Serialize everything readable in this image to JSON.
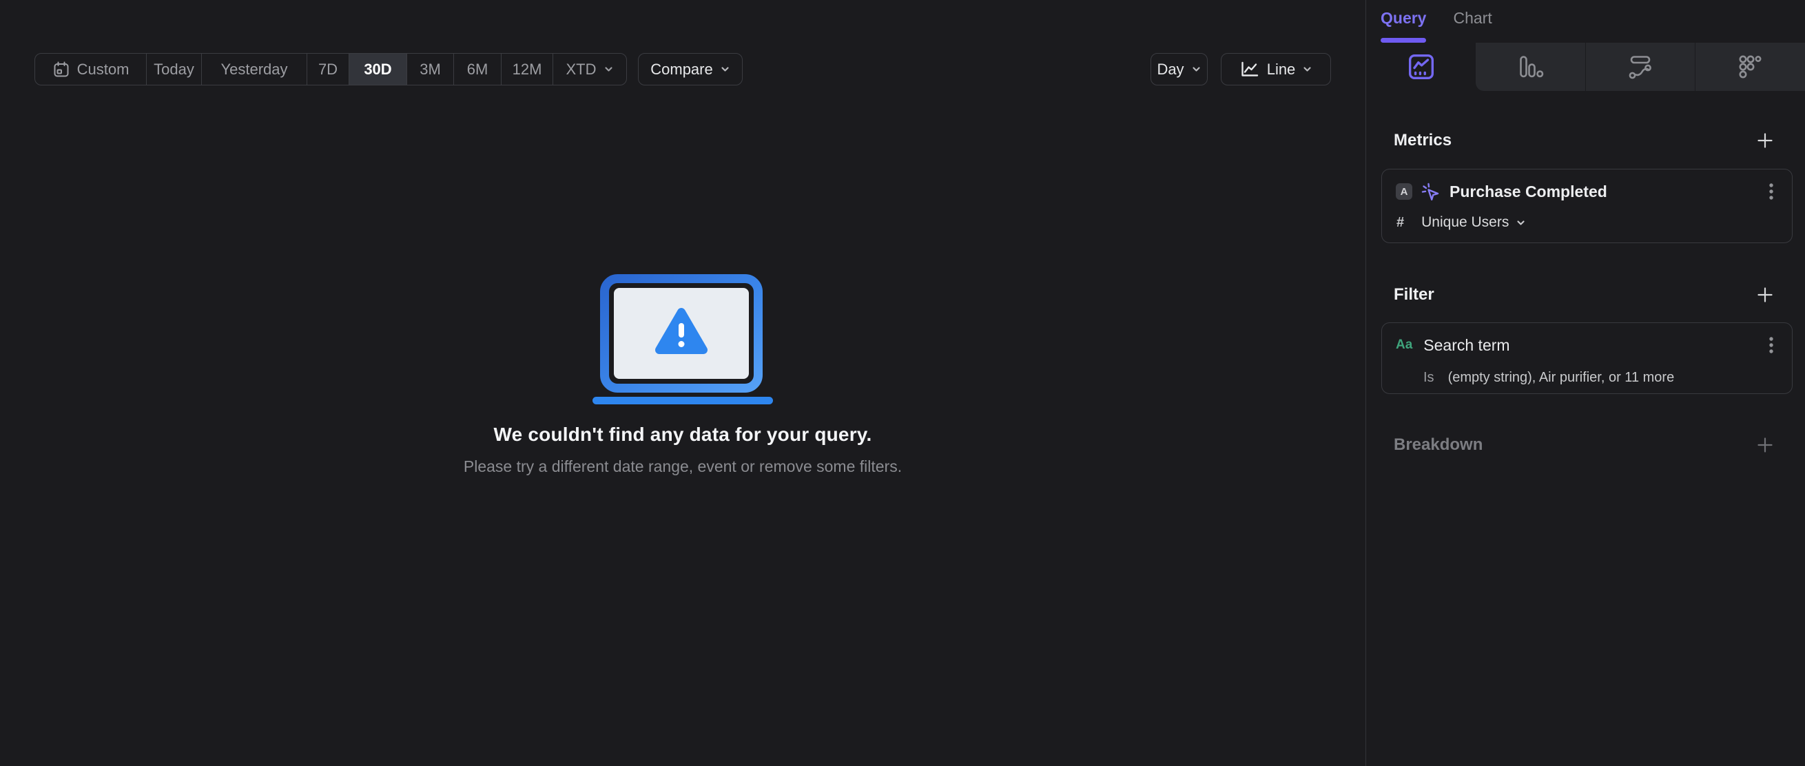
{
  "toolbar": {
    "date_ranges": [
      {
        "label": "Custom",
        "icon": "calendar-icon",
        "selected": false
      },
      {
        "label": "Today",
        "selected": false
      },
      {
        "label": "Yesterday",
        "selected": false
      },
      {
        "label": "7D",
        "selected": false
      },
      {
        "label": "30D",
        "selected": true
      },
      {
        "label": "3M",
        "selected": false
      },
      {
        "label": "6M",
        "selected": false
      },
      {
        "label": "12M",
        "selected": false
      },
      {
        "label": "XTD",
        "selected": false,
        "icon": "chevron-down-icon"
      }
    ],
    "compare_label": "Compare",
    "granularity_label": "Day",
    "chart_type_label": "Line",
    "chart_type_icon": "line-chart-icon"
  },
  "empty_state": {
    "illustration": "laptop-warning-illustration",
    "title": "We couldn't find any data for your query.",
    "subtitle": "Please try a different date range, event or remove some filters."
  },
  "sidebar": {
    "tabs": [
      {
        "label": "Query",
        "active": true
      },
      {
        "label": "Chart",
        "active": false
      }
    ],
    "icon_tabs": [
      {
        "icon": "insights-chart-icon",
        "active": true
      },
      {
        "icon": "funnel-bars-icon",
        "active": false
      },
      {
        "icon": "flows-icon",
        "active": false
      },
      {
        "icon": "retention-dots-icon",
        "active": false
      }
    ],
    "metrics": {
      "title": "Metrics",
      "add_icon": "plus-icon",
      "items": [
        {
          "letter": "A",
          "event_icon": "event-cursor-icon",
          "name": "Purchase Completed",
          "prefix": "#",
          "aggregation": "Unique Users",
          "menu_icon": "kebab-icon"
        }
      ]
    },
    "filter": {
      "title": "Filter",
      "add_icon": "plus-icon",
      "items": [
        {
          "type_label": "Aa",
          "name": "Search term",
          "operator": "Is",
          "value": "(empty string), Air purifier, or 11 more",
          "menu_icon": "kebab-icon"
        }
      ]
    },
    "breakdown": {
      "title": "Breakdown",
      "add_icon": "plus-icon"
    }
  },
  "colors": {
    "background": "#1b1b1e",
    "accent_purple": "#6f5bf2",
    "accent_blue": "#2e86ef",
    "green_type": "#3fa47c",
    "selected_segment": "#32343a",
    "border": "#3b3c41"
  }
}
